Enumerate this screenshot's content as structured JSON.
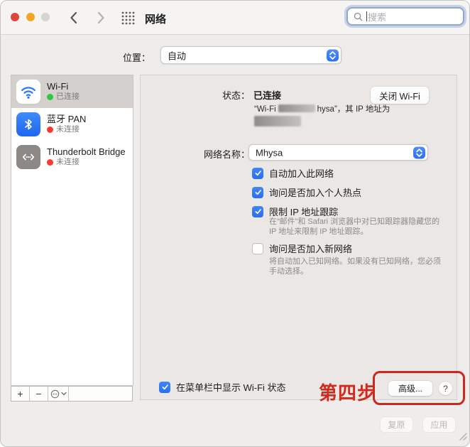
{
  "window": {
    "title": "网络"
  },
  "titlebar": {
    "search_placeholder": "搜索"
  },
  "location_bar": {
    "label": "位置：",
    "value": "自动"
  },
  "sidebar": {
    "items": [
      {
        "name": "Wi-Fi",
        "status": "已连接",
        "status_color": "#2ec73f",
        "icon": "wifi-icon",
        "selected": true
      },
      {
        "name": "蓝牙 PAN",
        "status": "未连接",
        "status_color": "#fb3b30",
        "icon": "bluetooth-icon",
        "selected": false
      },
      {
        "name": "Thunderbolt Bridge",
        "status": "未连接",
        "status_color": "#fb3b30",
        "icon": "thunderbolt-bridge-icon",
        "selected": false
      }
    ],
    "footer": {
      "add": "+",
      "remove": "−"
    }
  },
  "main": {
    "status": {
      "label": "状态：",
      "value": "已连接",
      "desc_prefix": "“Wi-Fi",
      "desc_suffix": "hysa”，其 IP 地址为"
    },
    "turn_off_wifi_button": "关闭 Wi-Fi",
    "network_name": {
      "label": "网络名称：",
      "value": "Mhysa"
    },
    "checkboxes": [
      {
        "label": "自动加入此网络",
        "checked": true
      },
      {
        "label": "询问是否加入个人热点",
        "checked": true
      },
      {
        "label": "限制 IP 地址跟踪",
        "checked": true,
        "desc": "在“邮件”和 Safari 浏览器中对已知跟踪器隐藏您的 IP 地址来限制 IP 地址跟踪。"
      },
      {
        "label": "询问是否加入新网络",
        "checked": false,
        "desc": "将自动加入已知网络。如果没有已知网络，您必须手动选择。"
      }
    ],
    "menubar_checkbox": {
      "label": "在菜单栏中显示 Wi-Fi 状态",
      "checked": true
    },
    "advanced_button": "高级...",
    "help_button": "?"
  },
  "annotation": {
    "step_label": "第四步",
    "color": "#d4291d"
  },
  "footer": {
    "revert_button": "复原",
    "apply_button": "应用"
  },
  "colors": {
    "accent_blue": "#2e7bf2",
    "connected_green": "#2ec73f",
    "disconnected_red": "#fb3b30",
    "annotation_red": "#cb291d",
    "selected_row": "#d3d0cd"
  }
}
